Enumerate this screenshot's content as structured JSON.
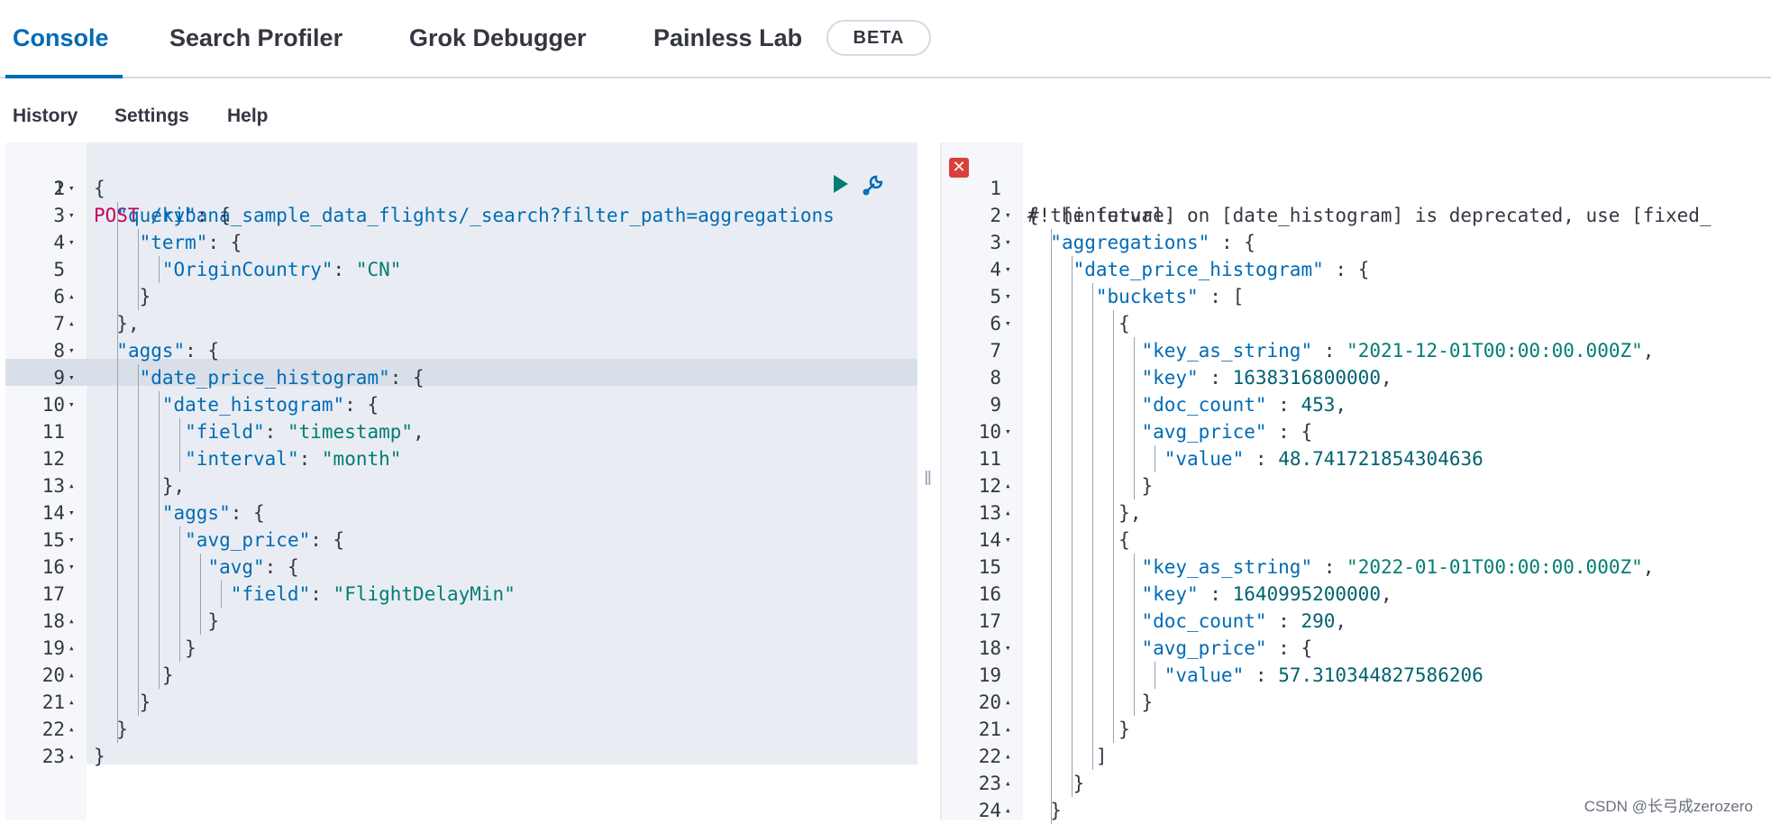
{
  "tabs": [
    {
      "label": "Console",
      "active": true
    },
    {
      "label": "Search Profiler",
      "active": false
    },
    {
      "label": "Grok Debugger",
      "active": false
    },
    {
      "label": "Painless Lab",
      "active": false
    }
  ],
  "beta_badge": "BETA",
  "menu": {
    "history": "History",
    "settings": "Settings",
    "help": "Help"
  },
  "request": {
    "method": "POST",
    "path": " /kibana_sample_data_flights/_search?filter_path=aggregations",
    "lines": [
      {
        "n": "1",
        "fold": "",
        "html": ""
      },
      {
        "n": "2",
        "fold": "▾",
        "text": "{"
      },
      {
        "n": "3",
        "fold": "▾",
        "text": "  \"query\": {"
      },
      {
        "n": "4",
        "fold": "▾",
        "text": "    \"term\": {"
      },
      {
        "n": "5",
        "fold": "",
        "text": "      \"OriginCountry\": \"CN\""
      },
      {
        "n": "6",
        "fold": "▴",
        "text": "    }"
      },
      {
        "n": "7",
        "fold": "▴",
        "text": "  },"
      },
      {
        "n": "8",
        "fold": "▾",
        "text": "  \"aggs\": {"
      },
      {
        "n": "9",
        "fold": "▾",
        "text": "    \"date_price_histogram\": {"
      },
      {
        "n": "10",
        "fold": "▾",
        "text": "      \"date_histogram\": {"
      },
      {
        "n": "11",
        "fold": "",
        "text": "        \"field\": \"timestamp\","
      },
      {
        "n": "12",
        "fold": "",
        "text": "        \"interval\": \"month\""
      },
      {
        "n": "13",
        "fold": "▴",
        "text": "      },"
      },
      {
        "n": "14",
        "fold": "▾",
        "text": "      \"aggs\": {"
      },
      {
        "n": "15",
        "fold": "▾",
        "text": "        \"avg_price\": {"
      },
      {
        "n": "16",
        "fold": "▾",
        "text": "          \"avg\": {"
      },
      {
        "n": "17",
        "fold": "",
        "text": "            \"field\": \"FlightDelayMin\""
      },
      {
        "n": "18",
        "fold": "▴",
        "text": "          }"
      },
      {
        "n": "19",
        "fold": "▴",
        "text": "        }"
      },
      {
        "n": "20",
        "fold": "▴",
        "text": "      }"
      },
      {
        "n": "21",
        "fold": "▴",
        "text": "    }"
      },
      {
        "n": "22",
        "fold": "▴",
        "text": "  }"
      },
      {
        "n": "23",
        "fold": "▴",
        "text": "}"
      }
    ]
  },
  "response": {
    "warning_line1": "#! [interval] on [date_histogram] is deprecated, use [fixed_",
    "warning_line2": "  the future.",
    "lines": [
      {
        "n": "2",
        "fold": "▾",
        "text": "{"
      },
      {
        "n": "3",
        "fold": "▾",
        "text": "  \"aggregations\" : {"
      },
      {
        "n": "4",
        "fold": "▾",
        "text": "    \"date_price_histogram\" : {"
      },
      {
        "n": "5",
        "fold": "▾",
        "text": "      \"buckets\" : ["
      },
      {
        "n": "6",
        "fold": "▾",
        "text": "        {"
      },
      {
        "n": "7",
        "fold": "",
        "text": "          \"key_as_string\" : \"2021-12-01T00:00:00.000Z\","
      },
      {
        "n": "8",
        "fold": "",
        "text": "          \"key\" : 1638316800000,"
      },
      {
        "n": "9",
        "fold": "",
        "text": "          \"doc_count\" : 453,"
      },
      {
        "n": "10",
        "fold": "▾",
        "text": "          \"avg_price\" : {"
      },
      {
        "n": "11",
        "fold": "",
        "text": "            \"value\" : 48.741721854304636"
      },
      {
        "n": "12",
        "fold": "▴",
        "text": "          }"
      },
      {
        "n": "13",
        "fold": "▴",
        "text": "        },"
      },
      {
        "n": "14",
        "fold": "▾",
        "text": "        {"
      },
      {
        "n": "15",
        "fold": "",
        "text": "          \"key_as_string\" : \"2022-01-01T00:00:00.000Z\","
      },
      {
        "n": "16",
        "fold": "",
        "text": "          \"key\" : 1640995200000,"
      },
      {
        "n": "17",
        "fold": "",
        "text": "          \"doc_count\" : 290,"
      },
      {
        "n": "18",
        "fold": "▾",
        "text": "          \"avg_price\" : {"
      },
      {
        "n": "19",
        "fold": "",
        "text": "            \"value\" : 57.310344827586206"
      },
      {
        "n": "20",
        "fold": "▴",
        "text": "          }"
      },
      {
        "n": "21",
        "fold": "▴",
        "text": "        }"
      },
      {
        "n": "22",
        "fold": "▴",
        "text": "      ]"
      },
      {
        "n": "23",
        "fold": "▴",
        "text": "    }"
      },
      {
        "n": "24",
        "fold": "▴",
        "text": "  }"
      }
    ]
  },
  "watermark": "CSDN @长弓成zerozero",
  "colors": {
    "accent": "#006bb4",
    "string": "#017d73",
    "method": "#c6005f",
    "error": "#d93f3c"
  }
}
